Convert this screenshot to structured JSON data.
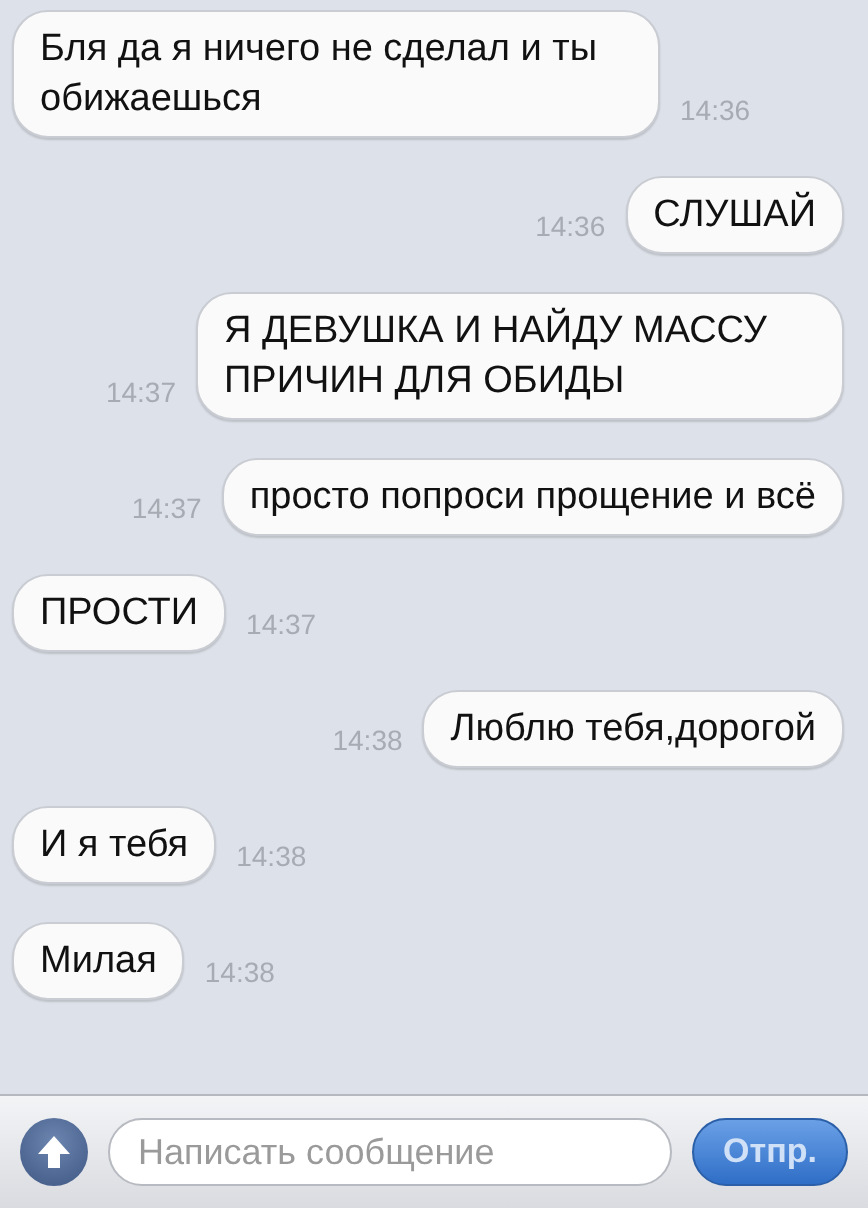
{
  "messages": [
    {
      "kind": "incoming",
      "text": "Бля да я ничего не сделал и ты обижаешься",
      "time": "14:36"
    },
    {
      "kind": "outgoing",
      "text": "СЛУШАЙ",
      "time": "14:36"
    },
    {
      "kind": "outgoing",
      "text": "Я ДЕВУШКА И НАЙДУ МАССУ ПРИЧИН ДЛЯ ОБИДЫ",
      "time": "14:37"
    },
    {
      "kind": "outgoing",
      "text": "просто попроси прощение и всё",
      "time": "14:37"
    },
    {
      "kind": "incoming",
      "text": "ПРОСТИ",
      "time": "14:37"
    },
    {
      "kind": "outgoing",
      "text": "Люблю тебя,дорогой",
      "time": "14:38"
    },
    {
      "kind": "incoming",
      "text": "И я тебя",
      "time": "14:38"
    },
    {
      "kind": "incoming",
      "text": "Милая",
      "time": "14:38"
    }
  ],
  "composer": {
    "placeholder": "Написать сообщение",
    "send": "Отпр."
  }
}
